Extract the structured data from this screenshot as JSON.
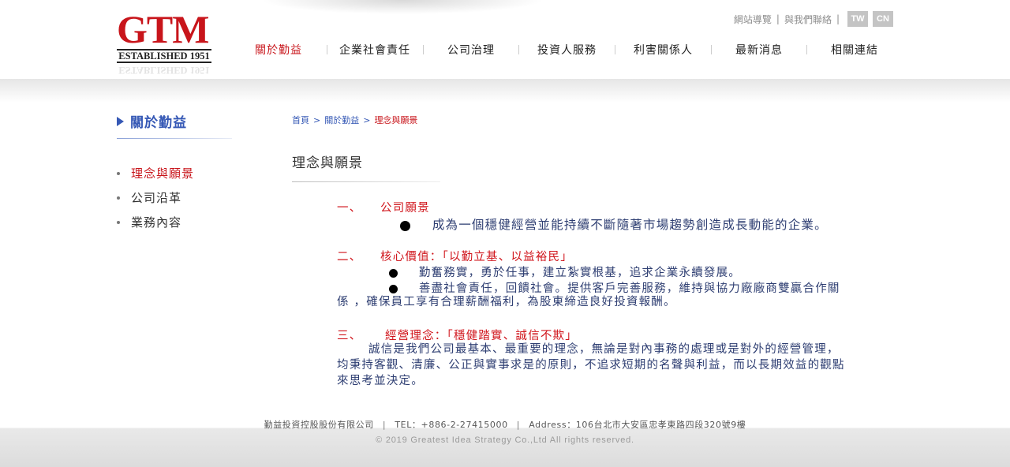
{
  "brand": {
    "logo_text": "GTM",
    "established": "ESTABLISHED 1951",
    "logo_color": "#c8151b"
  },
  "utility_nav": {
    "sitemap": "網站導覽",
    "contact": "與我們聯絡",
    "lang_tw": "TW",
    "lang_cn": "CN"
  },
  "main_nav": {
    "items": [
      {
        "label": "關於勤益",
        "active": true
      },
      {
        "label": "企業社會責任"
      },
      {
        "label": "公司治理"
      },
      {
        "label": "投資人服務"
      },
      {
        "label": "利害關係人"
      },
      {
        "label": "最新消息"
      },
      {
        "label": "相關連結"
      }
    ]
  },
  "sidebar": {
    "title": "關於勤益",
    "items": [
      {
        "label": "理念與願景",
        "active": true
      },
      {
        "label": "公司沿革"
      },
      {
        "label": "業務內容"
      }
    ]
  },
  "breadcrumb": {
    "home": "首頁",
    "section": "關於勤益",
    "current": "理念與願景",
    "separator": ">"
  },
  "page": {
    "title": "理念與願景",
    "sections": [
      {
        "number": "一、",
        "heading": "公司願景",
        "bullets": [
          "成為一個穩健經營並能持續不斷隨著市場趨勢創造成長動能的企業。"
        ]
      },
      {
        "number": "二、",
        "heading": "核心價值：「以勤立基、以益裕民」",
        "bullets": [
          "勤奮務實，勇於任事，建立紮實根基，追求企業永續發展。",
          "善盡社會責任，回饋社會。提供客戶完善服務，維持與協力廠廠商雙贏合作關"
        ],
        "continuation": "係 ，確保員工享有合理薪酬福利，為股東締造良好投資報酬。"
      },
      {
        "number": "三、",
        "heading": "經營理念：「穩健踏實、誠信不欺」",
        "paragraph_lines": [
          "誠信是我們公司最基本、最重要的理念，無論是對內事務的處理或是對外的經營管理，",
          "均秉持客觀、清廉、公正與實事求是的原則，不追求短期的名聲與利益，而以長期效益的觀點",
          "來思考並決定。"
        ]
      }
    ]
  },
  "footer": {
    "company": "勤益投資控股股份有限公司",
    "tel": "TEL：+886-2-27415000",
    "address": "Address：106台北市大安區忠孝東路四段320號9樓",
    "separator": "|",
    "copyright": "© 2019 Greatest Idea Strategy Co.,Ltd All rights reserved."
  },
  "colors": {
    "accent_red": "#c8151b",
    "accent_blue": "#3558b5",
    "body_text": "#2e3e72"
  }
}
